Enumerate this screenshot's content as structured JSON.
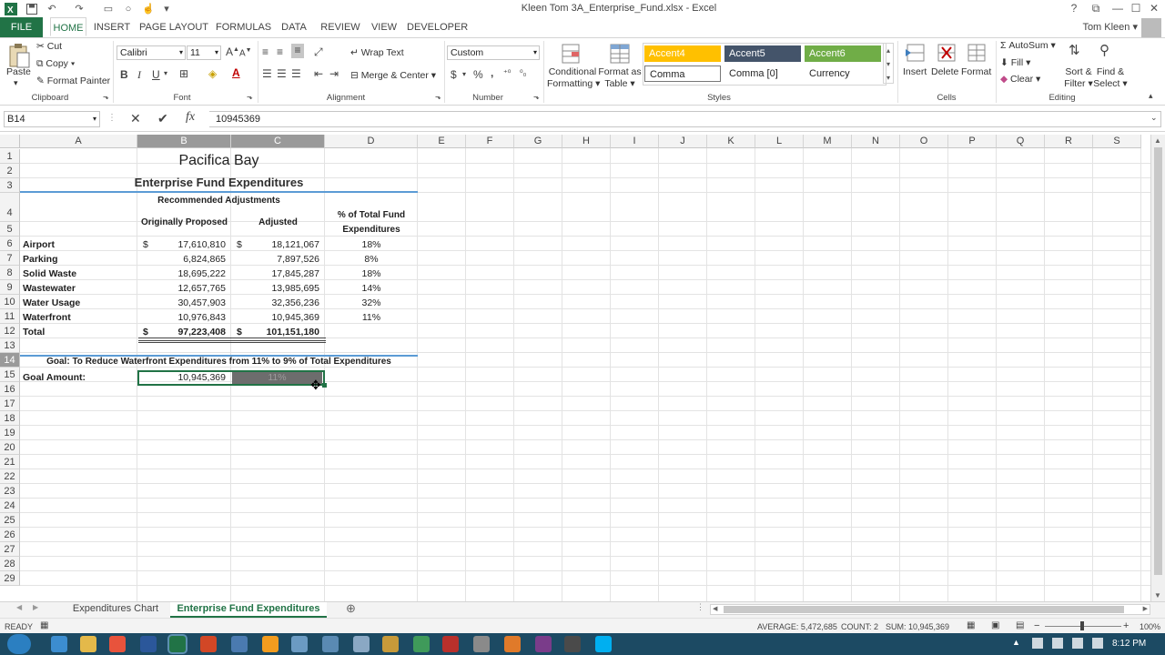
{
  "window": {
    "title": "Kleen Tom 3A_Enterprise_Fund.xlsx - Excel",
    "help": "?",
    "restore_ribbon": "⧉",
    "minimize": "—",
    "maximize": "☐",
    "close": "✕"
  },
  "ribbon_tabs": {
    "file": "FILE",
    "items": [
      "HOME",
      "INSERT",
      "PAGE LAYOUT",
      "FORMULAS",
      "DATA",
      "REVIEW",
      "VIEW",
      "DEVELOPER"
    ],
    "active": "HOME",
    "user": "Tom Kleen"
  },
  "clipboard": {
    "paste": "Paste",
    "cut": "Cut",
    "copy": "Copy",
    "format_painter": "Format Painter",
    "label": "Clipboard"
  },
  "font": {
    "name": "Calibri",
    "size": "11",
    "bold": "B",
    "italic": "I",
    "underline": "U",
    "grow": "A",
    "shrink": "A",
    "label": "Font"
  },
  "alignment": {
    "wrap_text": "Wrap Text",
    "merge_center": "Merge & Center",
    "label": "Alignment"
  },
  "number": {
    "format": "Custom",
    "currency": "$",
    "percent": "%",
    "comma": ",",
    "label": "Number"
  },
  "styles": {
    "conditional_1": "Conditional",
    "conditional_2": "Formatting",
    "format_table_1": "Format as",
    "format_table_2": "Table",
    "cells": [
      {
        "name": "Accent4",
        "bg": "#ffc000",
        "fg": "#ffffff"
      },
      {
        "name": "Accent5",
        "bg": "#44546a",
        "fg": "#ffffff"
      },
      {
        "name": "Accent6",
        "bg": "#70ad47",
        "fg": "#ffffff"
      },
      {
        "name": "Comma",
        "bg": "#ffffff",
        "fg": "#262626"
      },
      {
        "name": "Comma [0]",
        "bg": "#ffffff",
        "fg": "#262626"
      },
      {
        "name": "Currency",
        "bg": "#ffffff",
        "fg": "#262626"
      }
    ],
    "label": "Styles"
  },
  "cells_group": {
    "insert": "Insert",
    "delete": "Delete",
    "format": "Format",
    "label": "Cells"
  },
  "editing": {
    "autosum": "AutoSum",
    "fill": "Fill",
    "clear": "Clear",
    "sort_1": "Sort &",
    "sort_2": "Filter",
    "find_1": "Find &",
    "find_2": "Select",
    "label": "Editing"
  },
  "formula_bar": {
    "name_box": "B14",
    "value": "10945369",
    "fx": "fx"
  },
  "columns": [
    "A",
    "B",
    "C",
    "D",
    "E",
    "F",
    "G",
    "H",
    "I",
    "J",
    "K",
    "L",
    "M",
    "N",
    "O",
    "P",
    "Q",
    "R",
    "S"
  ],
  "rows": [
    "1",
    "2",
    "3",
    "4",
    "5",
    "6",
    "7",
    "8",
    "9",
    "10",
    "11",
    "12",
    "13",
    "14",
    "15",
    "16",
    "17",
    "18",
    "19",
    "20",
    "21",
    "22",
    "23",
    "24",
    "25",
    "26",
    "27",
    "28",
    "29"
  ],
  "sheet": {
    "title": "Pacifica Bay",
    "subtitle": "Enterprise Fund Expenditures",
    "heading": "Recommended Adjustments",
    "col_orig": "Originally Proposed",
    "col_adj": "Adjusted",
    "col_pct_1": "% of Total Fund",
    "col_pct_2": "Expenditures",
    "dollar": "$",
    "data_rows": [
      {
        "label": "Airport",
        "orig": "17,610,810",
        "adj": "18,121,067",
        "pct": "18%",
        "dollar": true
      },
      {
        "label": "Parking",
        "orig": "6,824,865",
        "adj": "7,897,526",
        "pct": "8%",
        "dollar": false
      },
      {
        "label": "Solid Waste",
        "orig": "18,695,222",
        "adj": "17,845,287",
        "pct": "18%",
        "dollar": false
      },
      {
        "label": "Wastewater",
        "orig": "12,657,765",
        "adj": "13,985,695",
        "pct": "14%",
        "dollar": false
      },
      {
        "label": "Water Usage",
        "orig": "30,457,903",
        "adj": "32,356,236",
        "pct": "32%",
        "dollar": false
      },
      {
        "label": "Waterfront",
        "orig": "10,976,843",
        "adj": "10,945,369",
        "pct": "11%",
        "dollar": false
      }
    ],
    "total_label": "Total",
    "total_orig": "97,223,408",
    "total_adj": "101,151,180",
    "goal_text": "Goal: To Reduce Waterfront Expenditures from 11% to 9% of Total Expenditures",
    "goal_label": "Goal Amount:",
    "goal_value": "10,945,369",
    "goal_pct": "11%"
  },
  "sheet_tabs": [
    "Expenditures Chart",
    "Enterprise Fund Expenditures"
  ],
  "active_sheet": "Enterprise Fund Expenditures",
  "status": {
    "mode": "READY",
    "average": "AVERAGE: 5,472,685",
    "count": "COUNT: 2",
    "sum": "SUM: 10,945,369",
    "zoom": "100%"
  },
  "taskbar": {
    "time": "8:12 PM"
  }
}
